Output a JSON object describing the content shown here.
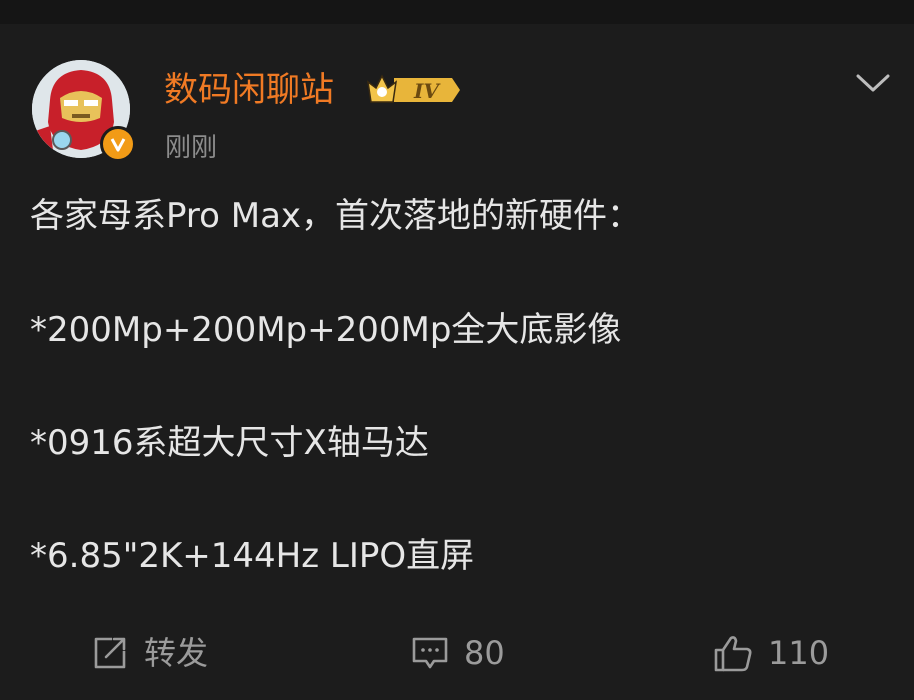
{
  "post": {
    "username": "数码闲聊站",
    "badge_level": "IV",
    "timestamp": "刚刚",
    "verified_icon": "v-verified-icon",
    "content_lines": [
      "各家母系Pro Max，首次落地的新硬件：",
      "*200Mp+200Mp+200Mp全大底影像",
      "*0916系超大尺寸X轴马达",
      "*6.85\"2K+144Hz LIPO直屏"
    ]
  },
  "actions": {
    "repost_label": "转发",
    "comment_count": "80",
    "like_count": "110"
  },
  "colors": {
    "background": "#1c1c1c",
    "username": "#f07a24",
    "text": "#e6e6e6",
    "muted": "#9b9b9b",
    "verified": "#f29b16",
    "badge_gold": "#e8b53a"
  }
}
